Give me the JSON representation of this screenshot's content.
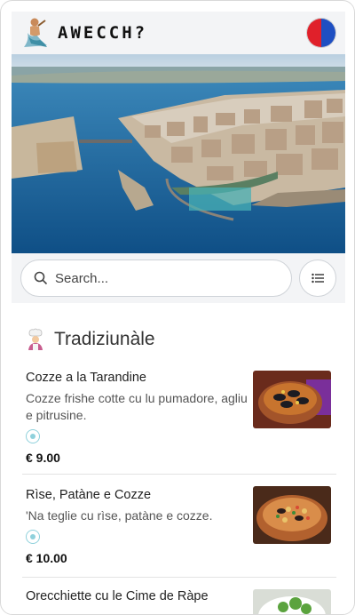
{
  "header": {
    "brand": "AWECCH?",
    "logo_icon": "merman-statue-icon",
    "language_icon": "language-flag-icon",
    "flag_colors": {
      "left": "#e0202a",
      "right": "#1e4fc2"
    }
  },
  "search": {
    "placeholder": "Search..."
  },
  "filter": {
    "icon": "list-icon"
  },
  "section": {
    "title": "Tradiziunàle",
    "icon": "chef-icon"
  },
  "menu_items": [
    {
      "name": "Cozze a la Tarandine",
      "description": "Cozze frishe cotte cu lu pumadore, agliu e pitrusine.",
      "allergen_icon": "allergen-icon",
      "price": "€ 9.00"
    },
    {
      "name": "Rìse, Patàne e Cozze",
      "description": "'Na teglie cu rìse, patàne e cozze.",
      "allergen_icon": "allergen-icon",
      "price": "€ 10.00"
    },
    {
      "name": "Orecchiette cu le Cime de Ràpe"
    }
  ]
}
